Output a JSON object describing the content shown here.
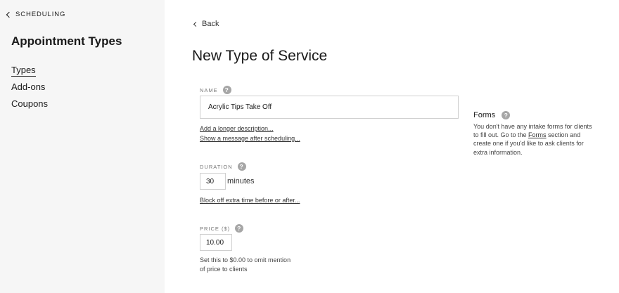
{
  "sidebar": {
    "breadcrumb": "SCHEDULING",
    "title": "Appointment Types",
    "items": [
      {
        "label": "Types",
        "active": true
      },
      {
        "label": "Add-ons",
        "active": false
      },
      {
        "label": "Coupons",
        "active": false
      }
    ]
  },
  "main": {
    "back_label": "Back",
    "title": "New Type of Service",
    "name": {
      "label": "NAME",
      "value": "Acrylic Tips Take Off",
      "description_link": "Add a longer description...",
      "message_link": "Show a message after scheduling..."
    },
    "duration": {
      "label": "DURATION",
      "value": "30",
      "unit": "minutes",
      "block_link": "Block off extra time before or after..."
    },
    "price": {
      "label": "PRICE ($)",
      "value": "10.00",
      "hint": "Set this to $0.00 to omit mention of price to clients"
    },
    "forms": {
      "title": "Forms",
      "text_before": "You don't have any intake forms for clients to fill out. Go to the ",
      "link": "Forms",
      "text_after": " section and create one if you'd like to ask clients for extra information."
    }
  },
  "icons": {
    "help": "?",
    "back": "chevron-left-icon"
  }
}
